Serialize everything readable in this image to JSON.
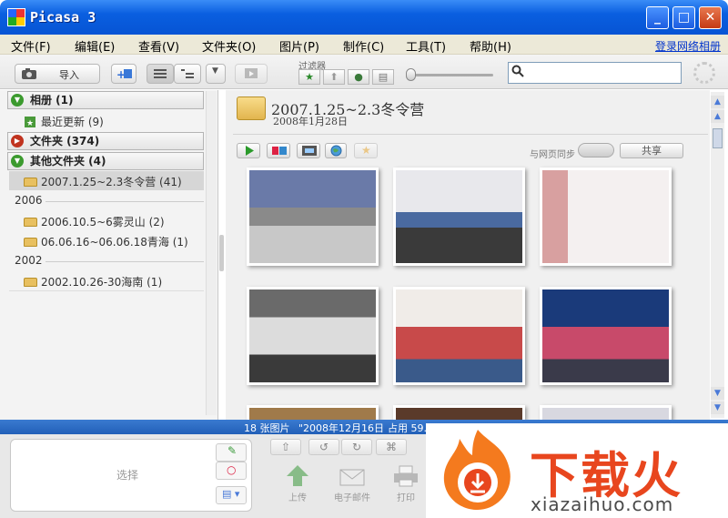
{
  "window": {
    "title": "Picasa 3",
    "minimize": "_",
    "maximize": "□",
    "close": "✕"
  },
  "menu": [
    "文件(F)",
    "编辑(E)",
    "查看(V)",
    "文件夹(O)",
    "图片(P)",
    "制作(C)",
    "工具(T)",
    "帮助(H)"
  ],
  "login_link": "登录网络相册",
  "toolbar": {
    "import_label": "导入",
    "filter_label": "过滤器",
    "search_placeholder": ""
  },
  "sidebar": {
    "sections": [
      {
        "label": "相册 (1)",
        "expanded": true
      },
      {
        "label": "文件夹 (374)",
        "expanded": false
      },
      {
        "label": "其他文件夹 (4)",
        "expanded": true
      }
    ],
    "recent": "最近更新 (9)",
    "other_first": "2007.1.25~2.3冬令营 (41)",
    "years": [
      {
        "year": "2006",
        "items": [
          "2006.10.5~6雾灵山 (2)",
          "06.06.16~06.06.18青海 (1)"
        ]
      },
      {
        "year": "2002",
        "items": [
          "2002.10.26-30海南 (1)"
        ]
      }
    ]
  },
  "album": {
    "title": "2007.1.25~2.3冬令营",
    "date": "2008年1月28日",
    "sync_label": "与网页同步",
    "share_label": "共享"
  },
  "status": {
    "count": "18 张图片",
    "date": "\"2008年12月16日",
    "size": "占用 59.6"
  },
  "tray": {
    "label": "选择"
  },
  "actions": {
    "upload": "上传",
    "email": "电子邮件",
    "print": "打印"
  },
  "watermark": {
    "text": "下载火",
    "url": "xiazaihuo.com"
  },
  "colors": {
    "title_bar": "#0654d4",
    "status_bar": "#2260b8",
    "watermark_orange": "#e8461e"
  }
}
